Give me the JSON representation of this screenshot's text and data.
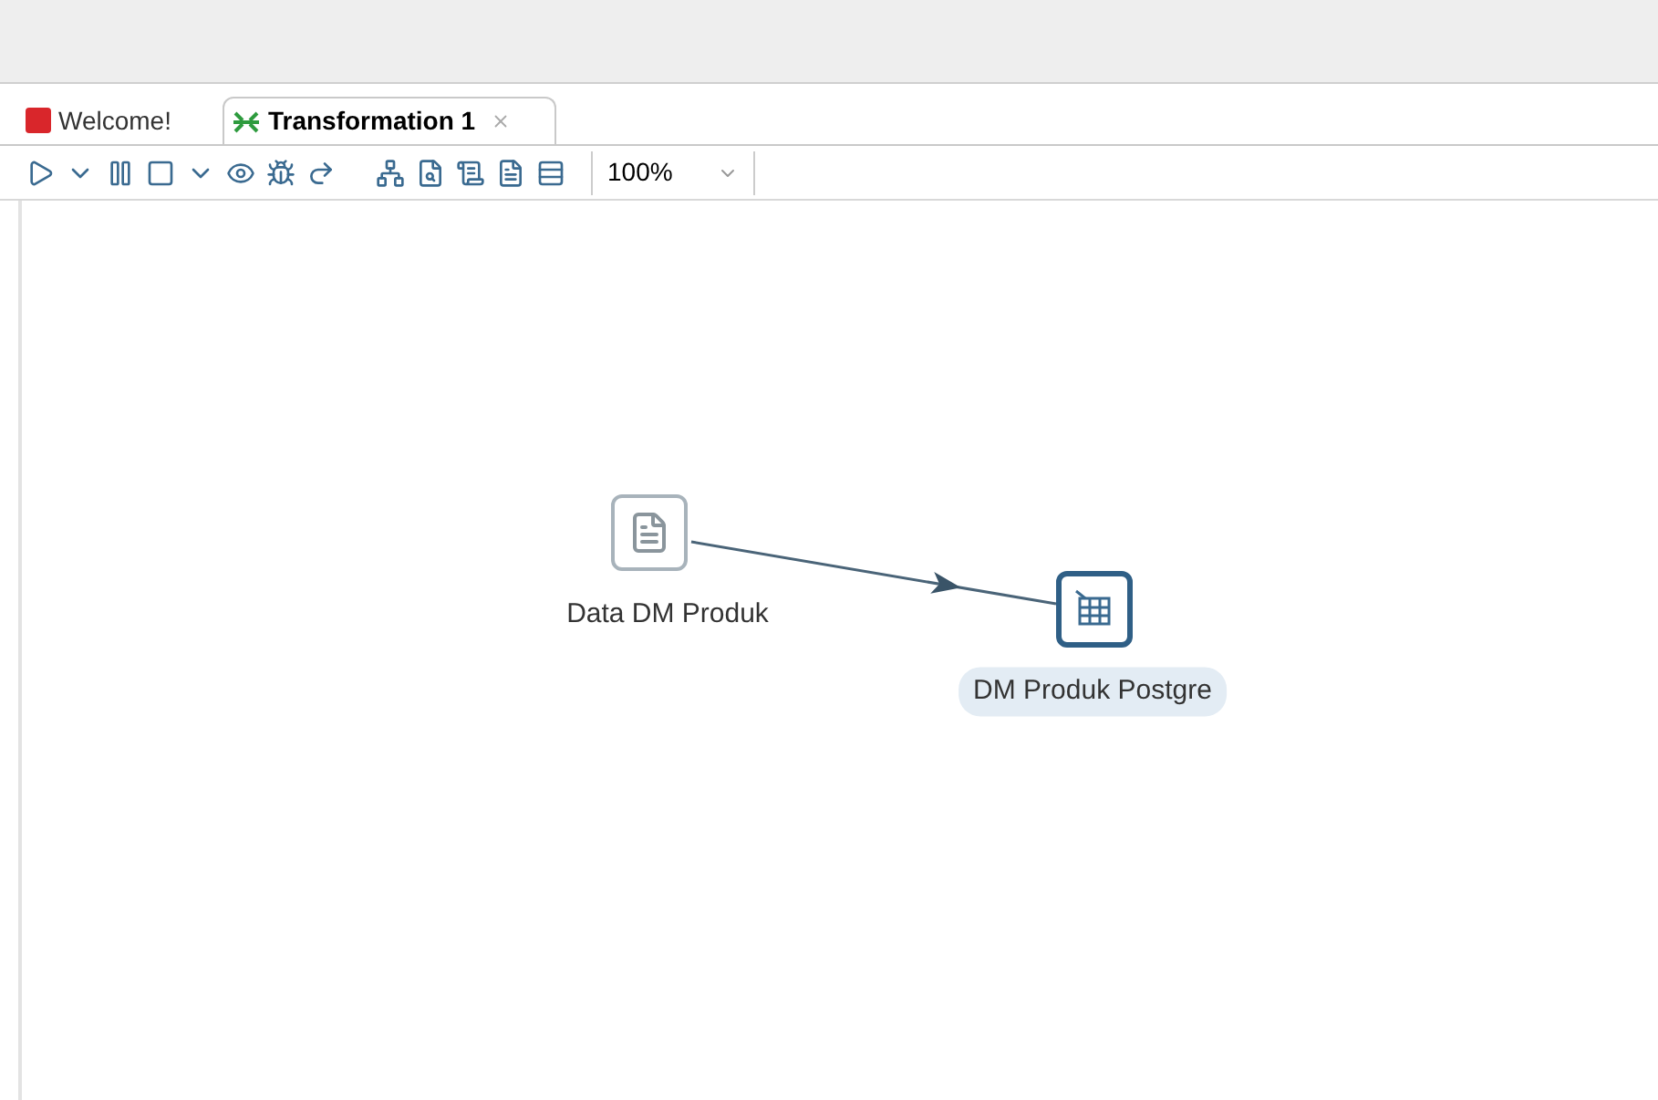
{
  "tabs": [
    {
      "label": "Welcome!",
      "kind": "welcome",
      "selected": false,
      "closable": false
    },
    {
      "label": "Transformation 1",
      "kind": "transformation",
      "selected": true,
      "closable": true
    }
  ],
  "toolbar": {
    "zoom": "100%"
  },
  "steps": [
    {
      "label": "Data DM Produk",
      "kind": "input",
      "selected": false
    },
    {
      "label": "DM Produk Postgre",
      "kind": "output",
      "selected": true
    }
  ]
}
